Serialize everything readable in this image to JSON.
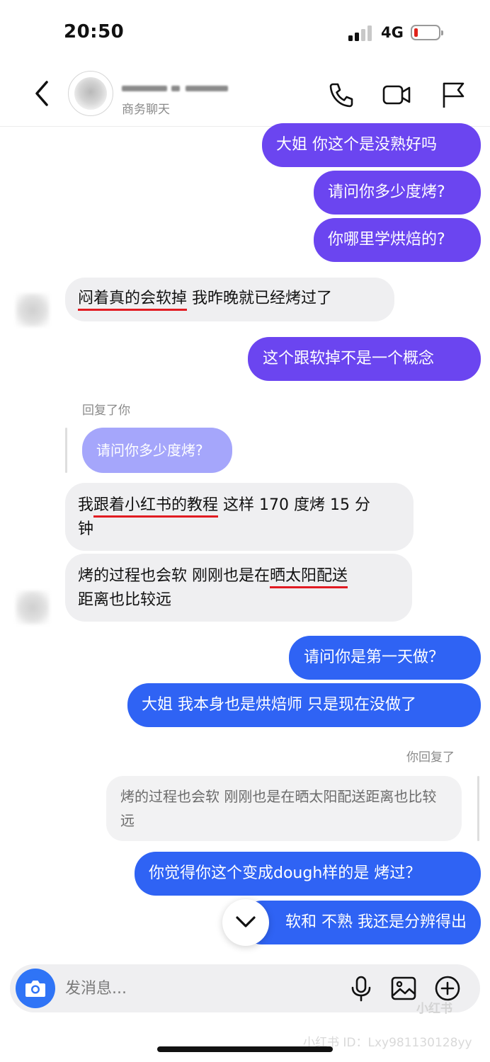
{
  "status_bar": {
    "time": "20:50",
    "network": "4G",
    "battery_level": 0.1
  },
  "header": {
    "subtitle": "商务聊天"
  },
  "messages": {
    "m1": "大姐 你这个是没熟好吗",
    "m2": "请问你多少度烤?",
    "m3": "你哪里学烘焙的?",
    "m4_underlined": "闷着真的会软掉",
    "m4_rest": " 我昨晚就已经烤过了",
    "m5": "这个跟软掉不是一个概念",
    "reply_label_1": "回复了你",
    "reply_quote_1": "请问你多少度烤?",
    "m6_pre": "我",
    "m6_underlined": "跟着小红书的教程",
    "m6_rest": " 这样 170 度烤 15 分",
    "m6_line2": "钟",
    "m7_pre": "烤的过程也会软 刚刚也是在",
    "m7_underlined": "晒太阳配送",
    "m7_line2": "距离也比较远",
    "m8": "请问你是第一天做？",
    "m9": "大姐 我本身也是烘焙师 只是现在没做了",
    "reply_label_2": "你回复了",
    "reply_quote_2": "烤的过程也会软 刚刚也是在晒太阳配送距离也比较远",
    "m10": "你觉得你这个变成dough样的是 烤过？",
    "m11": "软和 不熟 我还是分辨得出"
  },
  "input": {
    "placeholder": "发消息..."
  },
  "watermark": {
    "logo": "小红书",
    "id": "小红书 ID：Lxy981130128yy"
  },
  "colors": {
    "purple_bubble": "#6b45f0",
    "blue_bubble": "#2f63f4",
    "quote_bubble": "#a5a6fb",
    "incoming_bubble": "#efeff1",
    "underline": "#e11b22"
  },
  "icons": [
    "back-chevron-icon",
    "phone-icon",
    "video-camera-icon",
    "flag-icon",
    "chevron-down-icon",
    "camera-icon",
    "microphone-icon",
    "image-icon",
    "plus-circle-icon"
  ]
}
